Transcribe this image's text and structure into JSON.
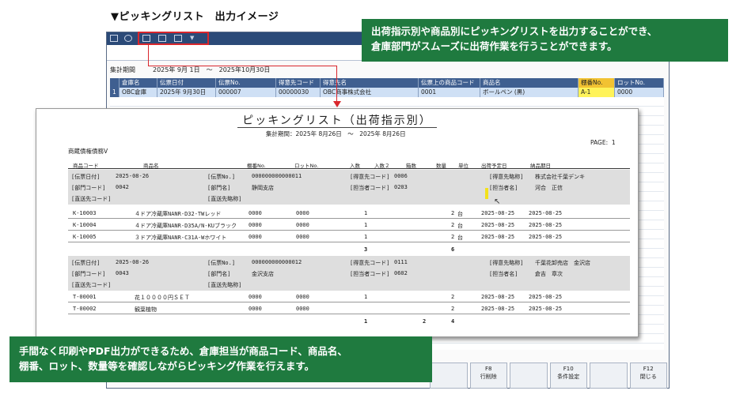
{
  "heading": "▼ピッキングリスト　出力イメージ",
  "callout_top": [
    "出荷指示別や商品別にピッキングリストを出力することができ、",
    "倉庫部門がスムーズに出荷作業を行うことができます。"
  ],
  "callout_bottom": [
    "手間なく印刷やPDF出力ができるため、倉庫担当が商品コード、商品名、",
    "棚番、ロット、数量等を確認しながらピッキング作業を行えます。"
  ],
  "app": {
    "period_label": "集計期間",
    "period_value": "2025年 9月 1日　～　2025年10月30日",
    "grid_headers": [
      "",
      "倉庫名",
      "伝票日付",
      "伝票No.",
      "得意先コード",
      "得意先名",
      "伝票上の商品コード",
      "商品名",
      "棚番No.",
      "ロットNo."
    ],
    "grid_row": [
      "1",
      "OBC倉庫",
      "2025年 9月30日",
      "000007",
      "00000030",
      "OBC商事株式会社",
      "0001",
      "ボールペン (黒)",
      "A-1",
      "0000"
    ],
    "fkeys": [
      {
        "key": "",
        "label": ""
      },
      {
        "key": "F8",
        "label": "行削除"
      },
      {
        "key": "",
        "label": ""
      },
      {
        "key": "F10",
        "label": "条件設定"
      },
      {
        "key": "",
        "label": ""
      },
      {
        "key": "F12",
        "label": "閉じる"
      }
    ]
  },
  "report": {
    "title": "ピッキングリスト（出荷指示別）",
    "period": "集計期間：2025年 8月26日　～　2025年 8月26日",
    "page_label": "PAGE:",
    "page_number": "1",
    "company": "商蔵債権債務V",
    "columns": {
      "code": "商品コード",
      "name": "商品名",
      "shelf": "棚番No.",
      "lot": "ロットNo.",
      "in": "入数",
      "in2": "入数２",
      "box": "箱数",
      "qty": "数量",
      "unit": "単位",
      "ship": "出荷予定日",
      "due": "納品期日"
    },
    "blocks": [
      {
        "date_label": "[伝票日付]",
        "date": "2025-08-26",
        "no_label": "[伝票No.]",
        "no": "000000000000011",
        "cust_label": "[得意先コード]",
        "cust_code": "0006",
        "cust_short_label": "[得意先略称]",
        "cust_short": "株式会社千葉デンキ",
        "dept_label": "[部門コード]",
        "dept": "0042",
        "dept_name_label": "[部門名]",
        "dept_name": "静岡支店",
        "staff_label": "[担当者コード]",
        "staff": "0203",
        "staff_name_label": "[担当者名]",
        "staff_name": "河合　正信",
        "dest_label": "[直送先コード]",
        "dest_short_label": "[直送先略称]",
        "items": [
          {
            "code": "K-10003",
            "name": "４ドア冷蔵庫NANR-D32-TWレッド",
            "shelf": "0000",
            "lot": "0000",
            "in": "1",
            "qty": "2",
            "unit": "台",
            "ship": "2025-08-25",
            "due": "2025-08-25"
          },
          {
            "code": "K-10004",
            "name": "４ドア冷蔵庫NANR-D35A/N-KUブラック",
            "shelf": "0000",
            "lot": "0000",
            "in": "1",
            "qty": "2",
            "unit": "台",
            "ship": "2025-08-25",
            "due": "2025-08-25"
          },
          {
            "code": "K-10005",
            "name": "３ドア冷蔵庫NANR-C31A-Wホワイト",
            "shelf": "0000",
            "lot": "0000",
            "in": "1",
            "qty": "2",
            "unit": "台",
            "ship": "2025-08-25",
            "due": "2025-08-25"
          }
        ],
        "total_in": "3",
        "total_box": "",
        "total_qty": "6"
      },
      {
        "date_label": "[伝票日付]",
        "date": "2025-08-26",
        "no_label": "[伝票No.]",
        "no": "000000000000012",
        "cust_label": "[得意先コード]",
        "cust_code": "0111",
        "cust_short_label": "[得意先略称]",
        "cust_short": "千葉花卸売店　金沢店",
        "dept_label": "[部門コード]",
        "dept": "0043",
        "dept_name_label": "[部門名]",
        "dept_name": "金沢支店",
        "staff_label": "[担当者コード]",
        "staff": "0602",
        "staff_name_label": "[担当者名]",
        "staff_name": "倉吉　章次",
        "dest_label": "[直送先コード]",
        "dest_short_label": "[直送先略称]",
        "items": [
          {
            "code": "T-00001",
            "name": "花１００００円ＳＥＴ",
            "shelf": "0000",
            "lot": "0000",
            "in": "1",
            "qty": "2",
            "unit": "",
            "ship": "2025-08-25",
            "due": "2025-08-25"
          },
          {
            "code": "T-00002",
            "name": "観葉植物",
            "shelf": "0000",
            "lot": "0000",
            "in": "",
            "qty": "2",
            "unit": "",
            "ship": "2025-08-25",
            "due": "2025-08-25"
          }
        ],
        "total_in": "1",
        "total_box": "2",
        "total_qty": "4"
      }
    ]
  },
  "colors": {
    "accent_green": "#1f7a3f",
    "highlight_red": "#d9262c",
    "titlebar": "#2b4a78",
    "grid_header": "#3f5f90"
  }
}
